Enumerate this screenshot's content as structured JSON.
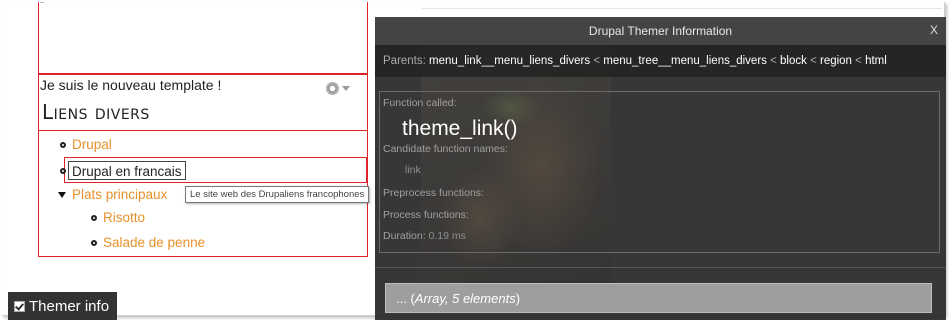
{
  "left": {
    "intro_text": "Je suis le nouveau template !",
    "block_title": "Liens divers",
    "menu": [
      {
        "label": "Drupal"
      },
      {
        "label": "Drupal en francais"
      },
      {
        "label": "Plats principaux"
      },
      {
        "label": "Risotto"
      },
      {
        "label": "Salade de penne"
      }
    ],
    "tooltip": "Le site web des Drupaliens francophones",
    "link_color": "#e8912a",
    "debug_border_color": "#e0222b"
  },
  "themer_toggle": {
    "label": "Themer info",
    "checked": true
  },
  "themer_panel": {
    "title": "Drupal Themer Information",
    "close": "X",
    "parents_label": "Parents:",
    "parents": [
      {
        "name": "menu_link__menu_liens_divers",
        "sep": " < "
      },
      {
        "name": "menu_tree__menu_liens_divers",
        "sep": " < "
      },
      {
        "name": "block",
        "sep": " < "
      },
      {
        "name": "region",
        "sep": " < "
      },
      {
        "name": "html",
        "sep": ""
      }
    ],
    "function_called_label": "Function called:",
    "function_name": "theme_link()",
    "candidate_label": "Candidate function names:",
    "candidate_value": "link",
    "preprocess_label": "Preprocess functions:",
    "process_label": "Process functions:",
    "duration_label": "Duration:",
    "duration_value": "0.19 ms",
    "array_prefix": "... (",
    "array_text": "Array, 5 elements",
    "array_suffix": ")"
  }
}
